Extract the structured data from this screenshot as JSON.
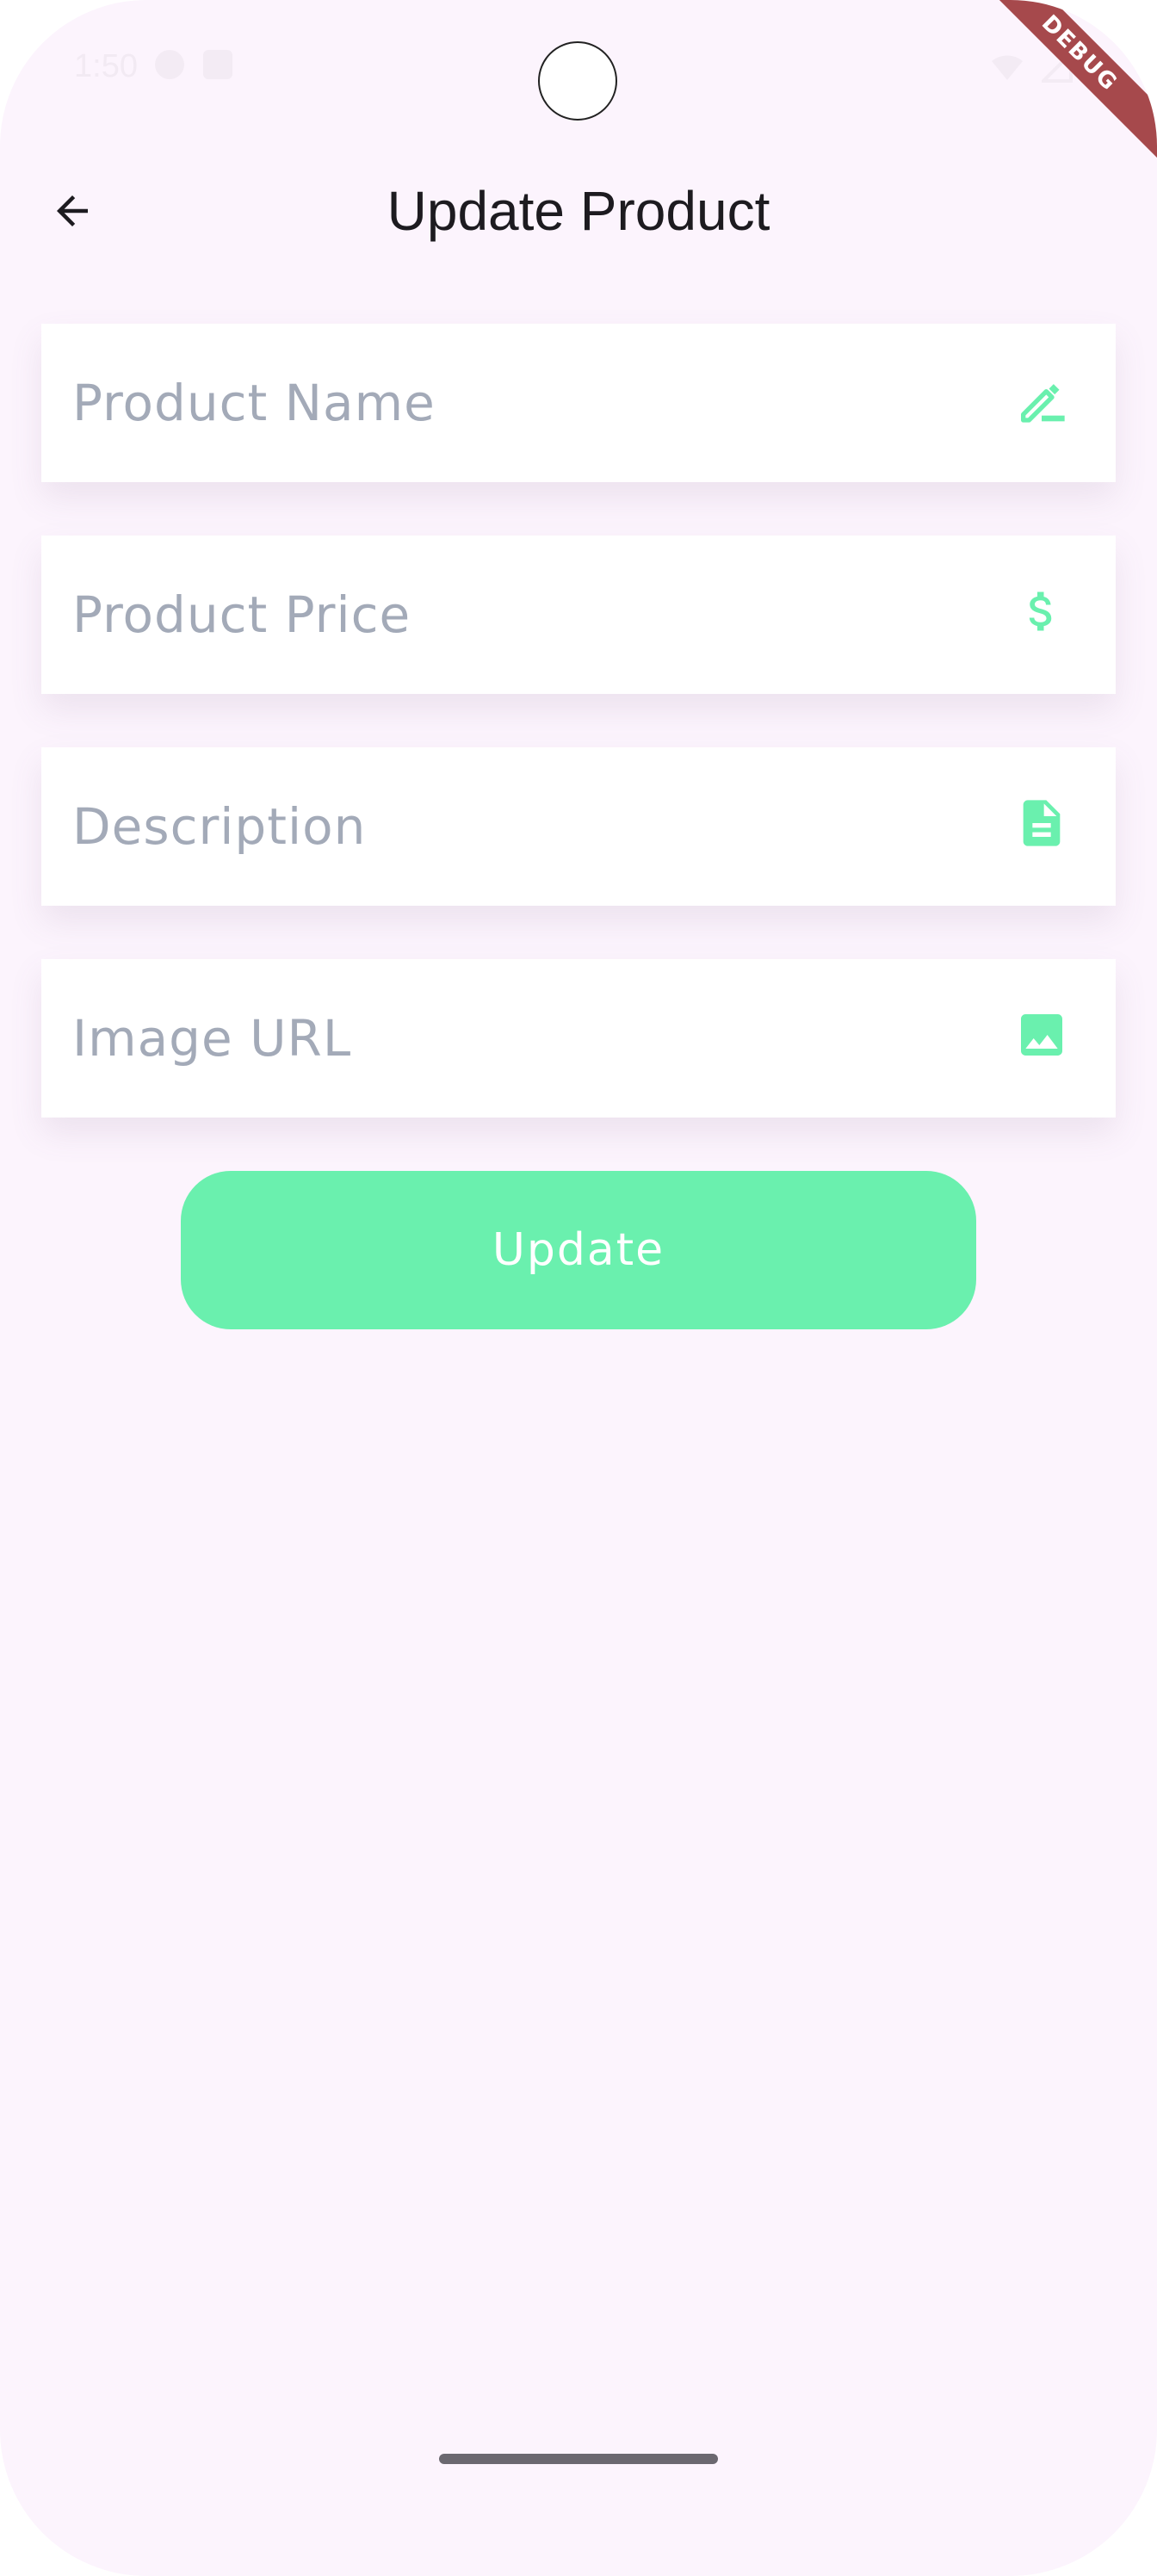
{
  "status_bar": {
    "time": "1:50"
  },
  "debug_banner": "DEBUG",
  "app_bar": {
    "title": "Update Product"
  },
  "form": {
    "fields": [
      {
        "placeholder": "Product Name",
        "icon": "edit-pencil-icon"
      },
      {
        "placeholder": "Product Price",
        "icon": "dollar-icon"
      },
      {
        "placeholder": "Description",
        "icon": "document-icon"
      },
      {
        "placeholder": "Image URL",
        "icon": "image-icon"
      }
    ],
    "submit_label": "Update"
  },
  "colors": {
    "background": "#fcf4fd",
    "accent": "#6af0ae",
    "placeholder": "#a3aab8",
    "title": "#1d1b20",
    "debug": "#a6494c"
  }
}
